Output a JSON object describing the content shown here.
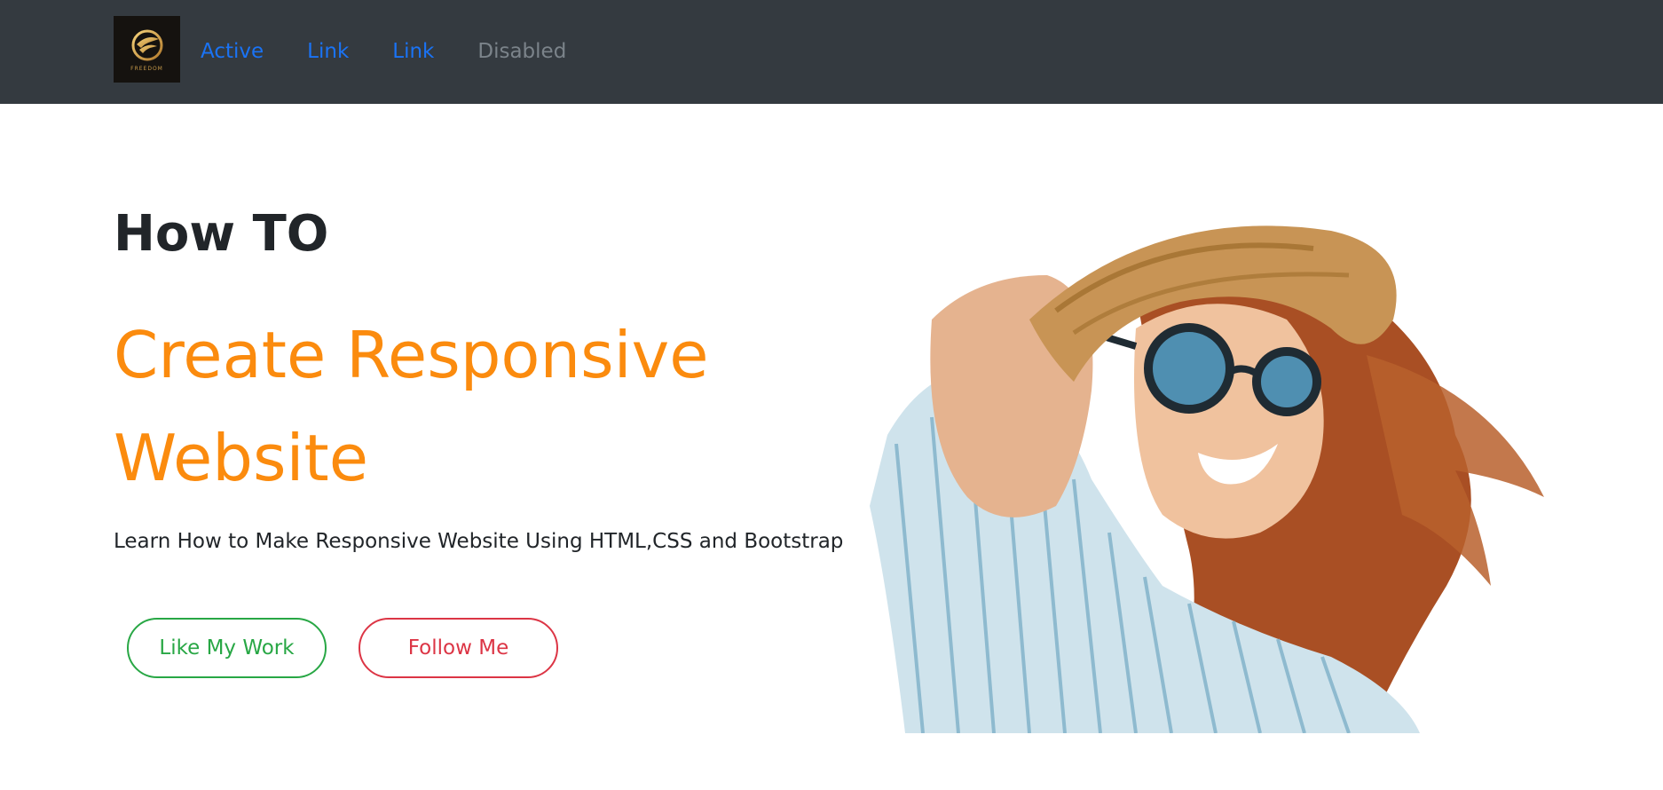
{
  "brand": {
    "logo_text": "FREEDOM",
    "colors": {
      "navbar_bg": "#343a40",
      "link": "#1a73f5",
      "disabled": "#7b838a",
      "accent_orange": "#fb8b0e",
      "green": "#28a745",
      "red": "#dc3545"
    }
  },
  "nav": {
    "links": [
      {
        "label": "Active"
      },
      {
        "label": "Link"
      },
      {
        "label": "Link"
      },
      {
        "label": "Disabled"
      }
    ]
  },
  "hero": {
    "title": "How TO",
    "headline": "Create Responsive Website",
    "subtitle": "Learn How to Make Responsive Website Using HTML,CSS and Bootstrap",
    "buttons": {
      "primary_label": "Like My Work",
      "secondary_label": "Follow Me"
    },
    "image": {
      "icon": "woman-in-straw-hat-photo"
    }
  }
}
